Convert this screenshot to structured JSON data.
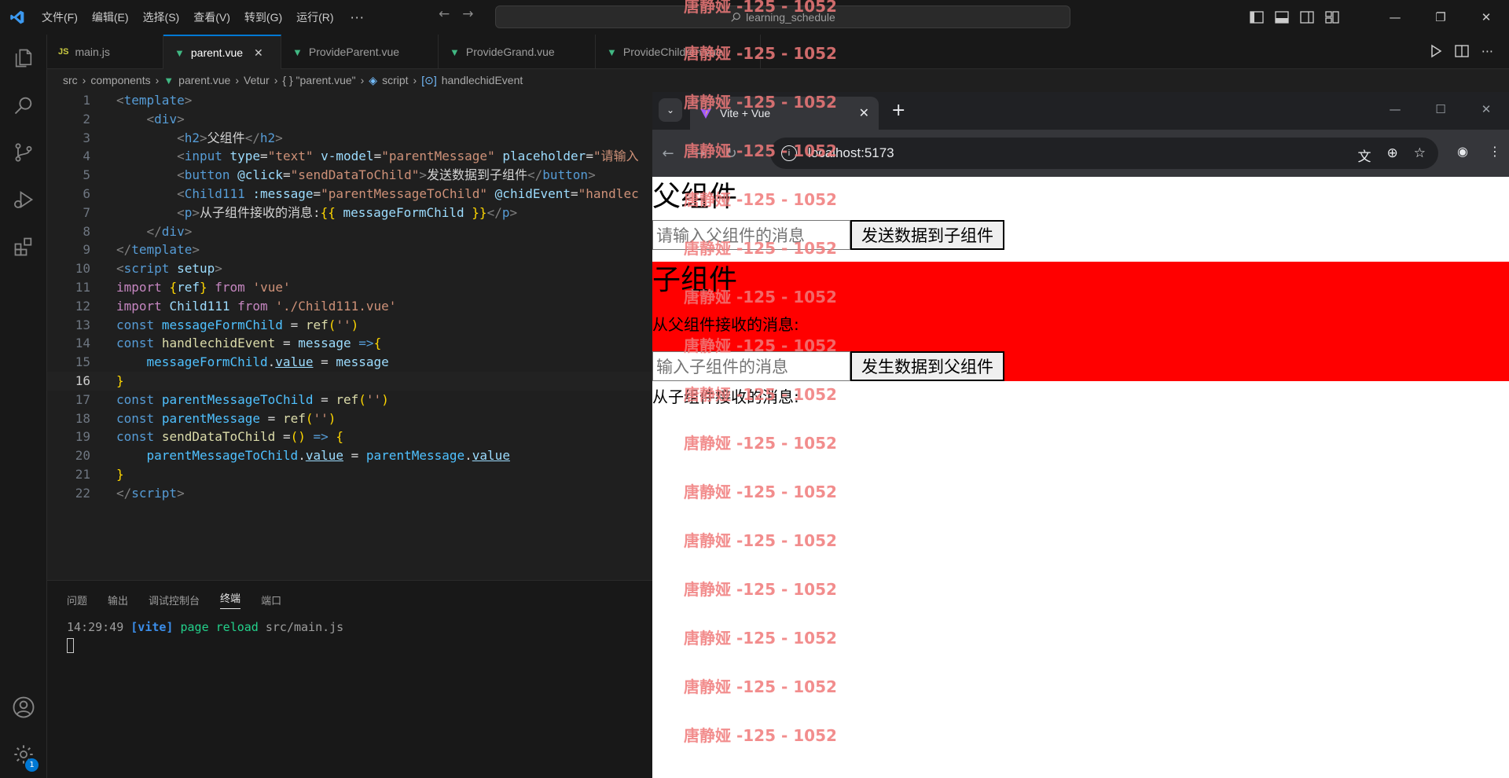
{
  "menu": [
    "文件(F)",
    "编辑(E)",
    "选择(S)",
    "查看(V)",
    "转到(G)",
    "运行(R)",
    "···"
  ],
  "search": {
    "text": "learning_schedule"
  },
  "tabs": [
    {
      "label": "main.js",
      "type": "js"
    },
    {
      "label": "parent.vue",
      "type": "vue",
      "active": true
    },
    {
      "label": "ProvideParent.vue",
      "type": "vue"
    },
    {
      "label": "ProvideGrand.vue",
      "type": "vue"
    },
    {
      "label": "ProvideChildren.vue",
      "type": "vue"
    }
  ],
  "breadcrumb": [
    "src",
    "components",
    "parent.vue",
    "Vetur",
    "{ } \"parent.vue\"",
    "script",
    "handlechidEvent"
  ],
  "code": {
    "line_numbers": [
      "1",
      "2",
      "3",
      "4",
      "5",
      "6",
      "7",
      "8",
      "9",
      "10",
      "11",
      "12",
      "13",
      "14",
      "15",
      "16",
      "17",
      "18",
      "19",
      "20",
      "21",
      "22"
    ],
    "current_line": "16"
  },
  "panel": {
    "tabs": [
      "问题",
      "输出",
      "调试控制台",
      "终端",
      "端口"
    ],
    "active_tab": "终端",
    "terminal": {
      "time": "14:29:49",
      "tag": "[vite]",
      "message": "page reload",
      "path": "src/main.js"
    }
  },
  "browser": {
    "tab_title": "Vite + Vue",
    "url": "localhost:5173"
  },
  "page": {
    "parent_heading": "父组件",
    "parent_input_placeholder": "请输入父组件的消息",
    "parent_button": "发送数据到子组件",
    "child_heading": "子组件",
    "child_received": "从父组件接收的消息:",
    "child_input_placeholder": "输入子组件的消息",
    "child_button": "发生数据到父组件",
    "parent_received": "从子组件接收的消息:"
  },
  "watermark": "唐静娅 -125 - 1052",
  "activity_badge": "1"
}
